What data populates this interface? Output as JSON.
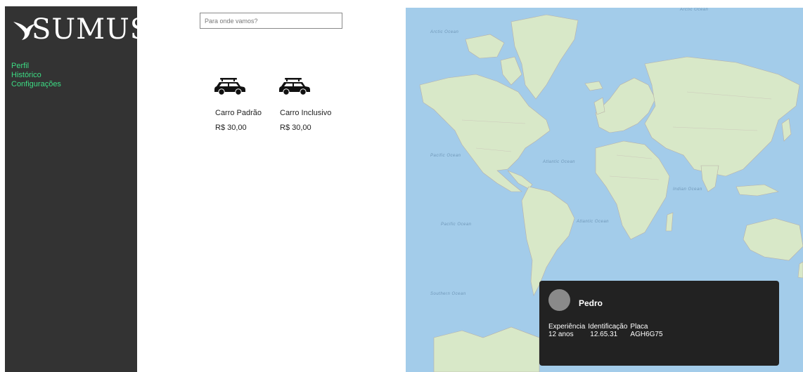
{
  "brand": {
    "name": "SUMUS"
  },
  "sidebar": {
    "items": [
      {
        "label": "Perfil"
      },
      {
        "label": "Histórico"
      },
      {
        "label": "Configurações"
      }
    ]
  },
  "search": {
    "placeholder": "Para onde vamos?",
    "value": ""
  },
  "cars": [
    {
      "name": "Carro Padrão",
      "price": "R$ 30,00",
      "icon": "car-icon"
    },
    {
      "name": "Carro Inclusivo",
      "price": "R$ 30,00",
      "icon": "car-icon"
    }
  ],
  "map": {
    "labels": {
      "arctic_top": "Arctic Ocean",
      "arctic_left": "Arctic Ocean",
      "pacific_north": "Pacific Ocean",
      "atlantic_north": "Atlantic Ocean",
      "indian": "Indian Ocean",
      "pacific_south": "Pacific Ocean",
      "atlantic_south": "Atlantic Ocean",
      "southern": "Southern Ocean"
    }
  },
  "driver": {
    "name": "Pedro",
    "stats": [
      {
        "label": "Experiência",
        "value": "12 anos"
      },
      {
        "label": "Identificação",
        "value": "12.65.31"
      },
      {
        "label": "Placa",
        "value": "AGH6G75"
      }
    ]
  },
  "colors": {
    "sidebar_bg": "#333333",
    "nav_link": "#3ddc84",
    "ocean": "#a3ccea",
    "land": "#d8e8c8",
    "card_bg": "#222222"
  }
}
